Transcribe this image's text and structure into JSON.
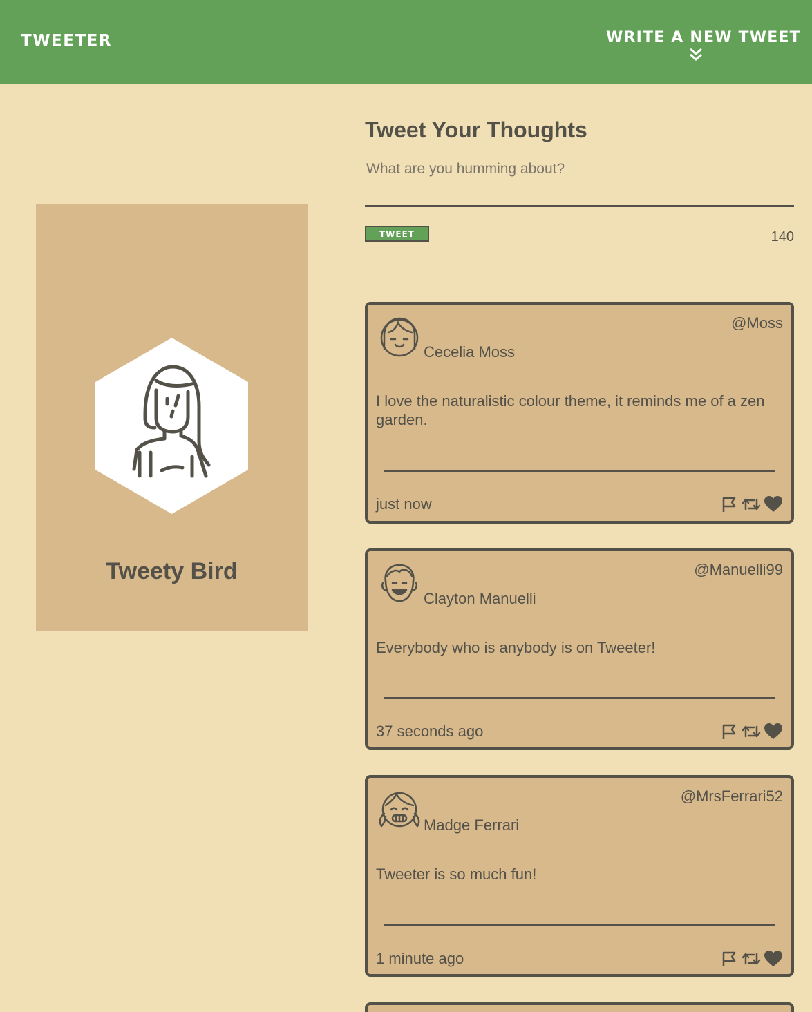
{
  "nav": {
    "brand": "Tweeter",
    "compose_label": "Write a new tweet",
    "brand_color": "#62a157"
  },
  "profile": {
    "name": "Tweety Bird",
    "avatar_icon": "woman-avatar-icon"
  },
  "compose": {
    "heading": "Tweet Your Thoughts",
    "placeholder": "What are you humming about?",
    "value": "",
    "button_label": "Tweet",
    "counter": "140"
  },
  "tweets": [
    {
      "name": "Cecelia Moss",
      "handle": "@Moss",
      "text": "I love the naturalistic colour theme, it reminds me of a zen garden.",
      "time": "just now",
      "avatar_icon": "girl-bangs-avatar-icon"
    },
    {
      "name": "Clayton Manuelli",
      "handle": "@Manuelli99",
      "text": "Everybody who is anybody is on Tweeter!",
      "time": "37 seconds ago",
      "avatar_icon": "boy-smiling-avatar-icon"
    },
    {
      "name": "Madge Ferrari",
      "handle": "@MrsFerrari52",
      "text": "Tweeter is so much fun!",
      "time": "1 minute ago",
      "avatar_icon": "girl-pigtails-avatar-icon"
    }
  ],
  "colors": {
    "background": "#f1dfb6",
    "card": "#d7b98c",
    "text": "#545149"
  }
}
